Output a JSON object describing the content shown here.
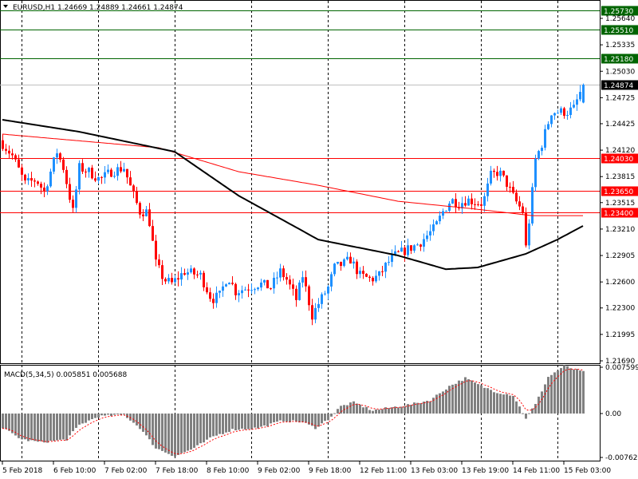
{
  "header": {
    "symbol_line": "EURUSD,H1  1.24669 1.24889 1.24661 1.24874"
  },
  "macd_label": "MACD(5,34,5) 0.005851 0.005688",
  "colors": {
    "bull": "#1e90ff",
    "bear": "#ff0000",
    "ma_fast": "#000000",
    "ma_slow": "#ff0000",
    "resistance": "#006400",
    "support": "#ff0000",
    "current": "#000000",
    "histogram": "#808080"
  },
  "chart_data": {
    "type": "candlestick",
    "title": "EURUSD,H1",
    "ohlc_last": {
      "open": 1.24669,
      "high": 1.24889,
      "low": 1.24661,
      "close": 1.24874
    },
    "ylim": [
      1.2169,
      1.2564
    ],
    "price_ticks": [
      "1.25640",
      "1.25335",
      "1.25030",
      "1.24725",
      "1.24425",
      "1.24120",
      "1.23815",
      "1.23515",
      "1.23210",
      "1.22905",
      "1.22600",
      "1.22300",
      "1.21995",
      "1.21690"
    ],
    "price_tick_values": [
      1.2564,
      1.25335,
      1.2503,
      1.24725,
      1.24425,
      1.2412,
      1.23815,
      1.23515,
      1.2321,
      1.22905,
      1.226,
      1.223,
      1.21995,
      1.2169
    ],
    "time_labels": [
      "5 Feb 2018",
      "6 Feb 10:00",
      "7 Feb 02:00",
      "7 Feb 18:00",
      "8 Feb 10:00",
      "9 Feb 02:00",
      "9 Feb 18:00",
      "12 Feb 11:00",
      "13 Feb 03:00",
      "13 Feb 19:00",
      "14 Feb 11:00",
      "15 Feb 03:00"
    ],
    "levels": [
      {
        "label": "1.25730",
        "value": 1.2573,
        "kind": "resistance"
      },
      {
        "label": "1.25510",
        "value": 1.2551,
        "kind": "resistance"
      },
      {
        "label": "1.25180",
        "value": 1.2518,
        "kind": "resistance"
      },
      {
        "label": "1.24874",
        "value": 1.24874,
        "kind": "current"
      },
      {
        "label": "1.24030",
        "value": 1.2403,
        "kind": "support"
      },
      {
        "label": "1.23650",
        "value": 1.2365,
        "kind": "support"
      },
      {
        "label": "1.23400",
        "value": 1.234,
        "kind": "support"
      }
    ],
    "close_keypoints_hour_price": [
      [
        0,
        1.24194
      ],
      [
        3,
        1.24056
      ],
      [
        7,
        1.23734
      ],
      [
        10.5,
        1.2378
      ],
      [
        13,
        1.23641
      ],
      [
        17,
        1.24102
      ],
      [
        19,
        1.23918
      ],
      [
        22,
        1.23411
      ],
      [
        24,
        1.23918
      ],
      [
        27,
        1.23872
      ],
      [
        30.5,
        1.2378
      ],
      [
        34,
        1.23872
      ],
      [
        38,
        1.23918
      ],
      [
        40.5,
        1.23641
      ],
      [
        43,
        1.23411
      ],
      [
        45.5,
        1.23411
      ],
      [
        48,
        1.22813
      ],
      [
        50.5,
        1.22628
      ],
      [
        53,
        1.22582
      ],
      [
        57,
        1.2272
      ],
      [
        62,
        1.22674
      ],
      [
        65.5,
        1.22398
      ],
      [
        68,
        1.22444
      ],
      [
        70.5,
        1.22674
      ],
      [
        73,
        1.2249
      ],
      [
        77,
        1.22536
      ],
      [
        80.5,
        1.22582
      ],
      [
        84,
        1.22536
      ],
      [
        87,
        1.2272
      ],
      [
        89,
        1.22628
      ],
      [
        92,
        1.22398
      ],
      [
        94,
        1.22674
      ],
      [
        97,
        1.22214
      ],
      [
        99,
        1.22352
      ],
      [
        102,
        1.22536
      ],
      [
        104,
        1.22766
      ],
      [
        107,
        1.22813
      ],
      [
        109,
        1.22859
      ],
      [
        112,
        1.22674
      ],
      [
        115.5,
        1.22628
      ],
      [
        118,
        1.22674
      ],
      [
        120.5,
        1.22813
      ],
      [
        123,
        1.22905
      ],
      [
        128,
        1.22997
      ],
      [
        130.5,
        1.23043
      ],
      [
        133,
        1.23135
      ],
      [
        135.5,
        1.23227
      ],
      [
        138,
        1.23411
      ],
      [
        140.5,
        1.23549
      ],
      [
        143,
        1.23503
      ],
      [
        145.5,
        1.23549
      ],
      [
        150.5,
        1.23503
      ],
      [
        153,
        1.23826
      ],
      [
        155.5,
        1.23872
      ],
      [
        158,
        1.23734
      ],
      [
        160.5,
        1.23549
      ],
      [
        163,
        1.23411
      ],
      [
        164,
        1.22997
      ],
      [
        165.5,
        1.23457
      ],
      [
        167,
        1.2401
      ],
      [
        169,
        1.24194
      ],
      [
        172,
        1.24562
      ],
      [
        177,
        1.24562
      ],
      [
        179,
        1.246
      ],
      [
        182,
        1.24874
      ]
    ],
    "ma_fast_keypoints": [
      [
        0,
        1.24471
      ],
      [
        24,
        1.24333
      ],
      [
        54,
        1.24102
      ],
      [
        74,
        1.23596
      ],
      [
        99,
        1.23089
      ],
      [
        124,
        1.22905
      ],
      [
        139,
        1.22747
      ],
      [
        149,
        1.22767
      ],
      [
        164,
        1.22923
      ],
      [
        174,
        1.23089
      ],
      [
        182,
        1.23246
      ]
    ],
    "ma_slow_keypoints": [
      [
        0,
        1.24305
      ],
      [
        49,
        1.24148
      ],
      [
        74,
        1.23872
      ],
      [
        99,
        1.23715
      ],
      [
        124,
        1.23531
      ],
      [
        149,
        1.23438
      ],
      [
        166,
        1.23365
      ],
      [
        182,
        1.23365
      ]
    ],
    "macd": {
      "label": "MACD(5,34,5)",
      "main": 0.005851,
      "signal": 0.005688,
      "ylim": [
        -0.00762,
        0.007599
      ],
      "ticks": [
        "0.007599",
        "0.00",
        "-0.00762"
      ],
      "tick_values": [
        0.007599,
        0,
        -0.00762
      ],
      "histogram_keypoints": [
        [
          0,
          -0.0025
        ],
        [
          6,
          -0.0045
        ],
        [
          12,
          -0.005
        ],
        [
          20,
          -0.0045
        ],
        [
          24,
          -0.002
        ],
        [
          30,
          -0.0005
        ],
        [
          38,
          -0.0002
        ],
        [
          43,
          -0.0025
        ],
        [
          48,
          -0.006
        ],
        [
          54,
          -0.0074
        ],
        [
          60,
          -0.006
        ],
        [
          66,
          -0.004
        ],
        [
          72,
          -0.0028
        ],
        [
          80,
          -0.0025
        ],
        [
          88,
          -0.0012
        ],
        [
          94,
          -0.0015
        ],
        [
          98,
          -0.0025
        ],
        [
          102,
          -0.001
        ],
        [
          106,
          0.0012
        ],
        [
          110,
          0.0018
        ],
        [
          116,
          0.0005
        ],
        [
          122,
          0.001
        ],
        [
          128,
          0.0015
        ],
        [
          134,
          0.0022
        ],
        [
          140,
          0.0045
        ],
        [
          145,
          0.0058
        ],
        [
          150,
          0.0045
        ],
        [
          155,
          0.0035
        ],
        [
          160,
          0.003
        ],
        [
          164,
          -0.0008
        ],
        [
          167,
          0.0015
        ],
        [
          171,
          0.006
        ],
        [
          176,
          0.0078
        ],
        [
          182,
          0.0068
        ]
      ]
    }
  }
}
